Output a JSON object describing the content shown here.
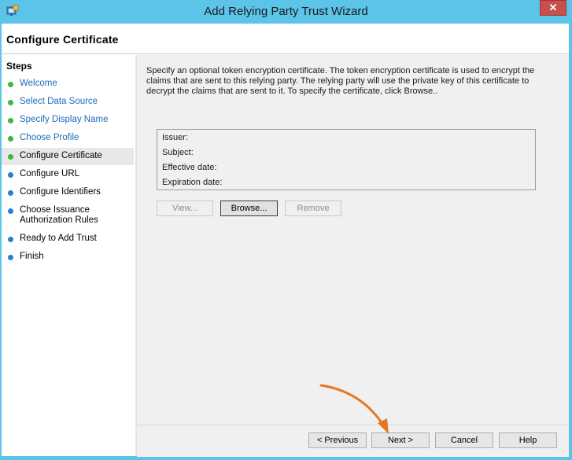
{
  "window": {
    "title": "Add Relying Party Trust Wizard",
    "close_glyph": "✕"
  },
  "header": {
    "page_title": "Configure Certificate"
  },
  "steps": {
    "heading": "Steps",
    "items": [
      {
        "label": "Welcome",
        "state": "done"
      },
      {
        "label": "Select Data Source",
        "state": "done"
      },
      {
        "label": "Specify Display Name",
        "state": "done"
      },
      {
        "label": "Choose Profile",
        "state": "done"
      },
      {
        "label": "Configure Certificate",
        "state": "current"
      },
      {
        "label": "Configure URL",
        "state": "pending"
      },
      {
        "label": "Configure Identifiers",
        "state": "pending"
      },
      {
        "label": "Choose Issuance",
        "label2": "Authorization Rules",
        "state": "pending"
      },
      {
        "label": "Ready to Add Trust",
        "state": "pending"
      },
      {
        "label": "Finish",
        "state": "pending"
      }
    ]
  },
  "main": {
    "description_line1": "Specify an optional token encryption certificate.  The token encryption certificate is used to encrypt the",
    "description_line2": "claims that are sent to this relying party.  The relying party will use the private key of this certificate to",
    "description_line3": "decrypt the claims that are sent to it.  To specify the certificate, click Browse..",
    "cert": {
      "issuer": "Issuer:",
      "subject": "Subject:",
      "effective_date": "Effective date:",
      "expiration_date": "Expiration date:"
    },
    "buttons": {
      "view": "View...",
      "browse": "Browse...",
      "remove": "Remove"
    }
  },
  "footer": {
    "previous": "< Previous",
    "next": "Next >",
    "cancel": "Cancel",
    "help": "Help"
  },
  "colors": {
    "titlebar": "#5bc4e8",
    "done_dot": "#3fb832",
    "pending_dot": "#2e7cd6",
    "annotation_arrow": "#e87722",
    "close": "#c7504b"
  }
}
